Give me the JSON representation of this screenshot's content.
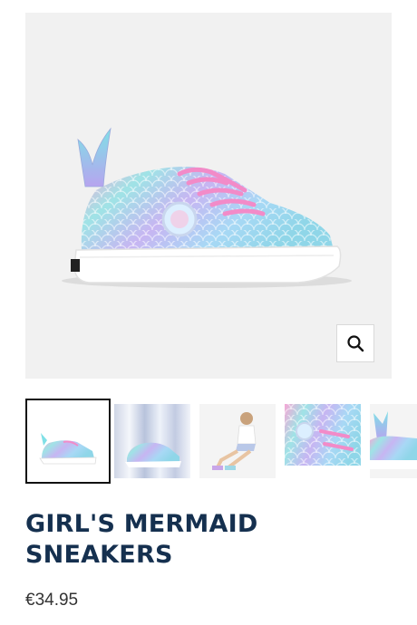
{
  "product": {
    "title_line1": "GIRL'S MERMAID",
    "title_line2": "SNEAKERS",
    "price": "€34.95"
  },
  "gallery": {
    "main_image": "mermaid-sneaker-side-view",
    "zoom_icon": "magnifier-icon",
    "thumbnails": [
      {
        "image": "sneaker-side-view",
        "active": true
      },
      {
        "image": "sneaker-on-holographic-background",
        "active": false
      },
      {
        "image": "girl-wearing-sneakers",
        "active": false
      },
      {
        "image": "sneaker-laces-closeup",
        "active": false
      },
      {
        "image": "sneaker-heel-closeup",
        "active": false
      }
    ]
  },
  "colors": {
    "title": "#15304f",
    "active_border": "#111111"
  }
}
